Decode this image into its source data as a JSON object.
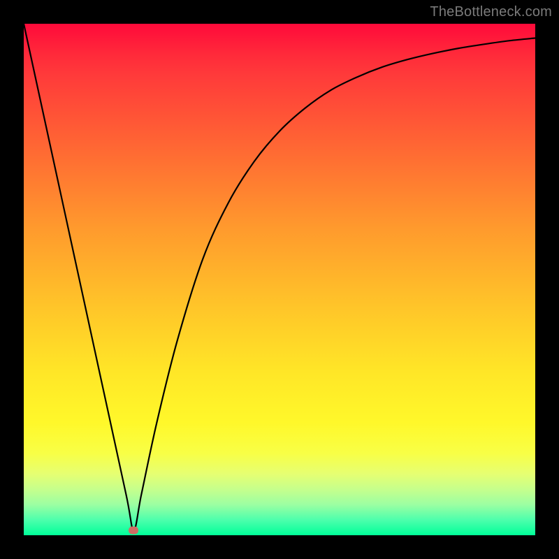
{
  "watermark": "TheBottleneck.com",
  "chart_data": {
    "type": "line",
    "title": "",
    "xlabel": "",
    "ylabel": "",
    "xlim": [
      0,
      1
    ],
    "ylim": [
      0,
      1
    ],
    "legend": false,
    "annotations": [],
    "series": [
      {
        "name": "bottleneck-curve",
        "x": [
          0.0,
          0.05,
          0.1,
          0.15,
          0.2,
          0.215,
          0.23,
          0.26,
          0.3,
          0.35,
          0.4,
          0.45,
          0.5,
          0.55,
          0.6,
          0.65,
          0.7,
          0.75,
          0.8,
          0.85,
          0.9,
          0.95,
          1.0
        ],
        "values": [
          1.0,
          0.77,
          0.54,
          0.31,
          0.08,
          0.01,
          0.08,
          0.22,
          0.38,
          0.54,
          0.65,
          0.73,
          0.79,
          0.835,
          0.87,
          0.895,
          0.915,
          0.93,
          0.942,
          0.952,
          0.96,
          0.967,
          0.972
        ]
      }
    ],
    "marker": {
      "x": 0.215,
      "y": 0.01,
      "color": "#cf6c64"
    },
    "background_gradient": {
      "stops": [
        {
          "pos": 0.0,
          "color": "#ff0a3a"
        },
        {
          "pos": 0.25,
          "color": "#ff6a33"
        },
        {
          "pos": 0.55,
          "color": "#ffc429"
        },
        {
          "pos": 0.78,
          "color": "#fff82a"
        },
        {
          "pos": 1.0,
          "color": "#00ff99"
        }
      ]
    }
  }
}
